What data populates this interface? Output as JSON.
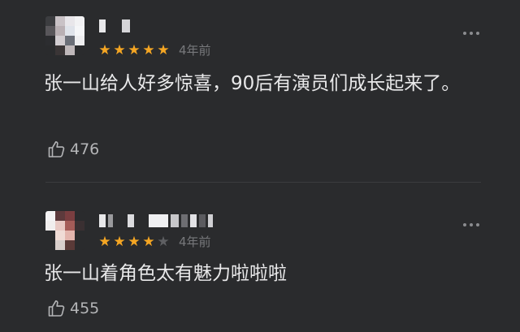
{
  "comments": [
    {
      "rating": 5,
      "stars": [
        "★",
        "★",
        "★",
        "★",
        "★"
      ],
      "time": "4年前",
      "text": "张一山给人好多惊喜，90后有演员们成长起来了。",
      "likes": "476"
    },
    {
      "rating": 4,
      "stars": [
        "★",
        "★",
        "★",
        "★",
        "★"
      ],
      "time": "4年前",
      "text": "张一山着角色太有魅力啦啦啦",
      "likes": "455"
    }
  ],
  "colors": {
    "background": "#2a2b2d",
    "star_active": "#f5a623",
    "star_inactive": "#5e5f62",
    "text": "#e9e9ea",
    "muted": "#77787b"
  },
  "icons": {
    "like": "thumbs-up-icon",
    "more": "more-dots-icon"
  }
}
